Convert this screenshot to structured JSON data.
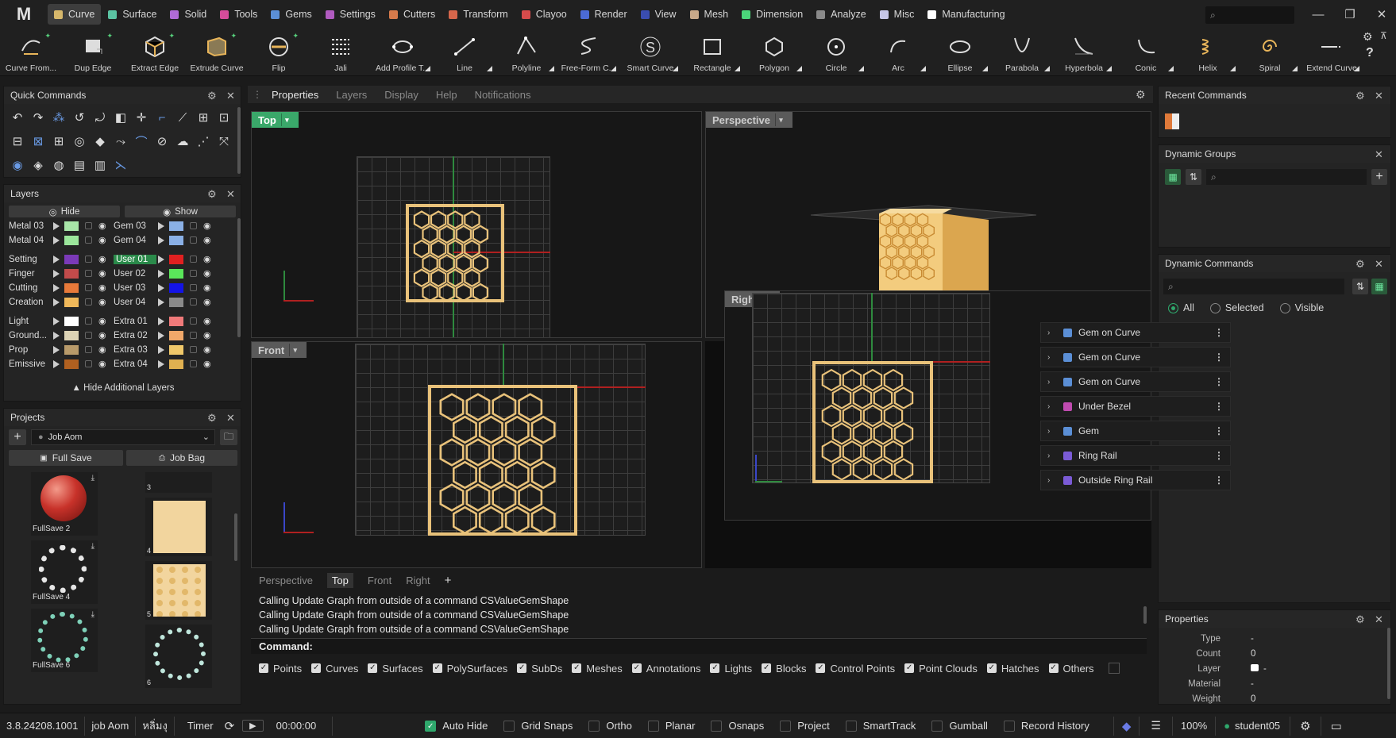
{
  "app": {
    "logo": "M"
  },
  "menu": [
    {
      "label": "Curve",
      "color": "#d6b76b",
      "active": true
    },
    {
      "label": "Surface",
      "color": "#5bc4a3"
    },
    {
      "label": "Solid",
      "color": "#b06bd6"
    },
    {
      "label": "Tools",
      "color": "#d64c9a"
    },
    {
      "label": "Gems",
      "color": "#5b8fd6"
    },
    {
      "label": "Settings",
      "color": "#b05bbf"
    },
    {
      "label": "Cutters",
      "color": "#d67a4b"
    },
    {
      "label": "Transform",
      "color": "#d6664b"
    },
    {
      "label": "Clayoo",
      "color": "#d64b4b"
    },
    {
      "label": "Render",
      "color": "#4b6bd6"
    },
    {
      "label": "View",
      "color": "#3a4db0"
    },
    {
      "label": "Mesh",
      "color": "#c8a98a"
    },
    {
      "label": "Dimension",
      "color": "#4bd67a"
    },
    {
      "label": "Analyze",
      "color": "#8a8a8a"
    },
    {
      "label": "Misc",
      "color": "#c6c6e6"
    },
    {
      "label": "Manufacturing",
      "color": "#ffffff"
    }
  ],
  "topsearch": {
    "placeholder": "⌕"
  },
  "toolbar": [
    {
      "label": "Curve From...",
      "icon": "curve-from-icon"
    },
    {
      "label": "Dup Edge",
      "icon": "dup-edge-icon"
    },
    {
      "label": "Extract Edge",
      "icon": "extract-edge-icon"
    },
    {
      "label": "Extrude Curve",
      "icon": "extrude-curve-icon"
    },
    {
      "label": "Flip",
      "icon": "flip-icon"
    },
    {
      "label": "Jali",
      "icon": "jali-icon"
    },
    {
      "label": "Add Profile T...",
      "icon": "add-profile-icon"
    },
    {
      "label": "Line",
      "icon": "line-icon"
    },
    {
      "label": "Polyline",
      "icon": "polyline-icon"
    },
    {
      "label": "Free-Form C...",
      "icon": "free-form-icon"
    },
    {
      "label": "Smart Curve",
      "icon": "smart-curve-icon"
    },
    {
      "label": "Rectangle",
      "icon": "rectangle-icon"
    },
    {
      "label": "Polygon",
      "icon": "polygon-icon"
    },
    {
      "label": "Circle",
      "icon": "circle-icon"
    },
    {
      "label": "Arc",
      "icon": "arc-icon"
    },
    {
      "label": "Ellipse",
      "icon": "ellipse-icon"
    },
    {
      "label": "Parabola",
      "icon": "parabola-icon"
    },
    {
      "label": "Hyperbola",
      "icon": "hyperbola-icon"
    },
    {
      "label": "Conic",
      "icon": "conic-icon"
    },
    {
      "label": "Helix",
      "icon": "helix-icon"
    },
    {
      "label": "Spiral",
      "icon": "spiral-icon"
    },
    {
      "label": "Extend Curve",
      "icon": "extend-curve-icon"
    }
  ],
  "quick_commands": {
    "title": "Quick Commands"
  },
  "layers": {
    "title": "Layers",
    "hide": "Hide",
    "show": "Show",
    "left": [
      {
        "name": "Metal 03",
        "color": "#a8e6a8"
      },
      {
        "name": "Metal 04",
        "color": "#9be69b"
      },
      {
        "name": "Setting",
        "color": "#7b3ab8"
      },
      {
        "name": "Finger",
        "color": "#c24b4b"
      },
      {
        "name": "Cutting",
        "color": "#e87a3a"
      },
      {
        "name": "Creation",
        "color": "#f0b85a"
      },
      {
        "name": "Light",
        "color": "#ffffff"
      },
      {
        "name": "Ground...",
        "color": "#ddd3b5"
      },
      {
        "name": "Prop",
        "color": "#b89a6a"
      },
      {
        "name": "Emissive",
        "color": "#b06020"
      }
    ],
    "right": [
      {
        "name": "Gem 03",
        "color": "#8ab0e6"
      },
      {
        "name": "Gem 04",
        "color": "#8ab0e6"
      },
      {
        "name": "User 01",
        "color": "#e02020"
      },
      {
        "name": "User 02",
        "color": "#5ae65a"
      },
      {
        "name": "User 03",
        "color": "#1414e6"
      },
      {
        "name": "User 04",
        "color": "#8a8a8a"
      },
      {
        "name": "Extra 01",
        "color": "#f07a7a"
      },
      {
        "name": "Extra 02",
        "color": "#f0a86a"
      },
      {
        "name": "Extra 03",
        "color": "#f0c86a"
      },
      {
        "name": "Extra 04",
        "color": "#e0b050"
      }
    ],
    "hide_additional": "Hide Additional Layers"
  },
  "projects": {
    "title": "Projects",
    "job": "Job Aom",
    "full_save": "Full Save",
    "job_bag": "Job Bag",
    "thumbs_left": [
      "FullSave 2",
      "FullSave 4",
      "FullSave 6"
    ],
    "thumbs_right": [
      "3",
      "4",
      "5",
      "6"
    ]
  },
  "panel_tabs": [
    "Properties",
    "Layers",
    "Display",
    "Help",
    "Notifications"
  ],
  "viewports": {
    "top": "Top",
    "perspective": "Perspective",
    "front": "Front",
    "right": "Right"
  },
  "view_tabs": [
    "Perspective",
    "Top",
    "Front",
    "Right",
    "+"
  ],
  "console": {
    "lines": [
      "Calling Update Graph from outside of a command CSValueGemShape",
      "Calling Update Graph from outside of a command CSValueGemShape",
      "Calling Update Graph from outside of a command CSValueGemShape"
    ],
    "command_label": "Command:"
  },
  "filters": [
    "Points",
    "Curves",
    "Surfaces",
    "PolySurfaces",
    "SubDs",
    "Meshes",
    "Annotations",
    "Lights",
    "Blocks",
    "Control Points",
    "Point Clouds",
    "Hatches",
    "Others"
  ],
  "recent_commands": {
    "title": "Recent Commands"
  },
  "dynamic_groups": {
    "title": "Dynamic Groups"
  },
  "dynamic_commands": {
    "title": "Dynamic Commands",
    "radios": [
      "All",
      "Selected",
      "Visible"
    ],
    "items": [
      {
        "label": "Gem on Curve",
        "color": "#5b8fd6"
      },
      {
        "label": "Gem on Curve",
        "color": "#5b8fd6"
      },
      {
        "label": "Gem on Curve",
        "color": "#5b8fd6"
      },
      {
        "label": "Under Bezel",
        "color": "#c04bb0"
      },
      {
        "label": "Gem",
        "color": "#5b8fd6"
      },
      {
        "label": "Ring Rail",
        "color": "#7b5bd6"
      },
      {
        "label": "Outside Ring Rail",
        "color": "#7b5bd6"
      }
    ]
  },
  "properties": {
    "title": "Properties",
    "rows": [
      {
        "k": "Type",
        "v": "-"
      },
      {
        "k": "Count",
        "v": "0"
      },
      {
        "k": "Layer",
        "v": "-"
      },
      {
        "k": "Material",
        "v": "-"
      },
      {
        "k": "Weight",
        "v": "0"
      }
    ]
  },
  "status": {
    "version": "3.8.24208.1001",
    "job": "job Aom",
    "thai": "หลิ่มงุ",
    "timer": "Timer",
    "time": "00:00:00",
    "toggles": [
      {
        "label": "Auto Hide",
        "on": true
      },
      {
        "label": "Grid Snaps",
        "on": false
      },
      {
        "label": "Ortho",
        "on": false
      },
      {
        "label": "Planar",
        "on": false
      },
      {
        "label": "Osnaps",
        "on": false
      },
      {
        "label": "Project",
        "on": false
      },
      {
        "label": "SmartTrack",
        "on": false
      },
      {
        "label": "Gumball",
        "on": false
      },
      {
        "label": "Record History",
        "on": false
      }
    ],
    "zoom": "100%",
    "user": "student05"
  }
}
